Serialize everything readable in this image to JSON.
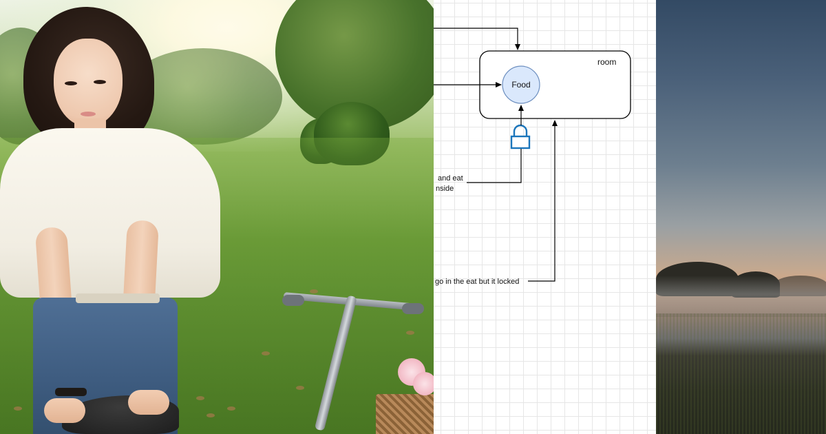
{
  "left_photo": {
    "subject": "photo-park-woman-bicycle"
  },
  "diagram": {
    "container_label": "room",
    "node_label": "Food",
    "label_eat_inside_line1": "and eat",
    "label_eat_inside_line2": "nside",
    "label_locked": "go in the eat but it locked",
    "lock_icon": "lock-icon",
    "colors": {
      "node_fill": "#dae8fc",
      "node_stroke": "#6c8ebf",
      "lock_color": "#1b75bb",
      "edge": "#000000"
    }
  },
  "right_photo": {
    "subject": "photo-misty-field-dusk"
  }
}
